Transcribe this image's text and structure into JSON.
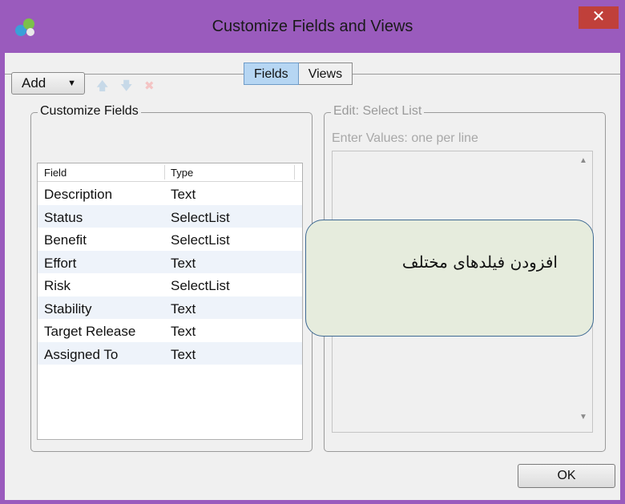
{
  "window": {
    "title": "Customize Fields and Views",
    "close_glyph": "✕"
  },
  "tabs": [
    {
      "label": "Fields",
      "active": true
    },
    {
      "label": "Views",
      "active": false
    }
  ],
  "customize_fields": {
    "label": "Customize Fields",
    "add_label": "Add",
    "columns": [
      "Field",
      "Type"
    ],
    "rows": [
      {
        "field": "Description",
        "type": "Text"
      },
      {
        "field": "Status",
        "type": "SelectList"
      },
      {
        "field": "Benefit",
        "type": "SelectList"
      },
      {
        "field": "Effort",
        "type": "Text"
      },
      {
        "field": "Risk",
        "type": "SelectList"
      },
      {
        "field": "Stability",
        "type": "Text"
      },
      {
        "field": "Target Release",
        "type": "Text"
      },
      {
        "field": "Assigned To",
        "type": "Text"
      }
    ]
  },
  "edit_panel": {
    "label": "Edit: Select List",
    "hint": "Enter Values: one per line"
  },
  "ok_label": "OK",
  "callout": {
    "text": "افزودن فیلدهای مختلف"
  },
  "icons": {
    "app": "app-icon",
    "move_up": "arrow-up-icon",
    "move_down": "arrow-down-icon",
    "delete": "delete-x-icon"
  },
  "colors": {
    "titlebar": "#9a5bbd",
    "active_tab": "#b6d6f3",
    "close": "#c0403a",
    "callout_fill": "#e6ecdd",
    "callout_border": "#3f6a93"
  }
}
